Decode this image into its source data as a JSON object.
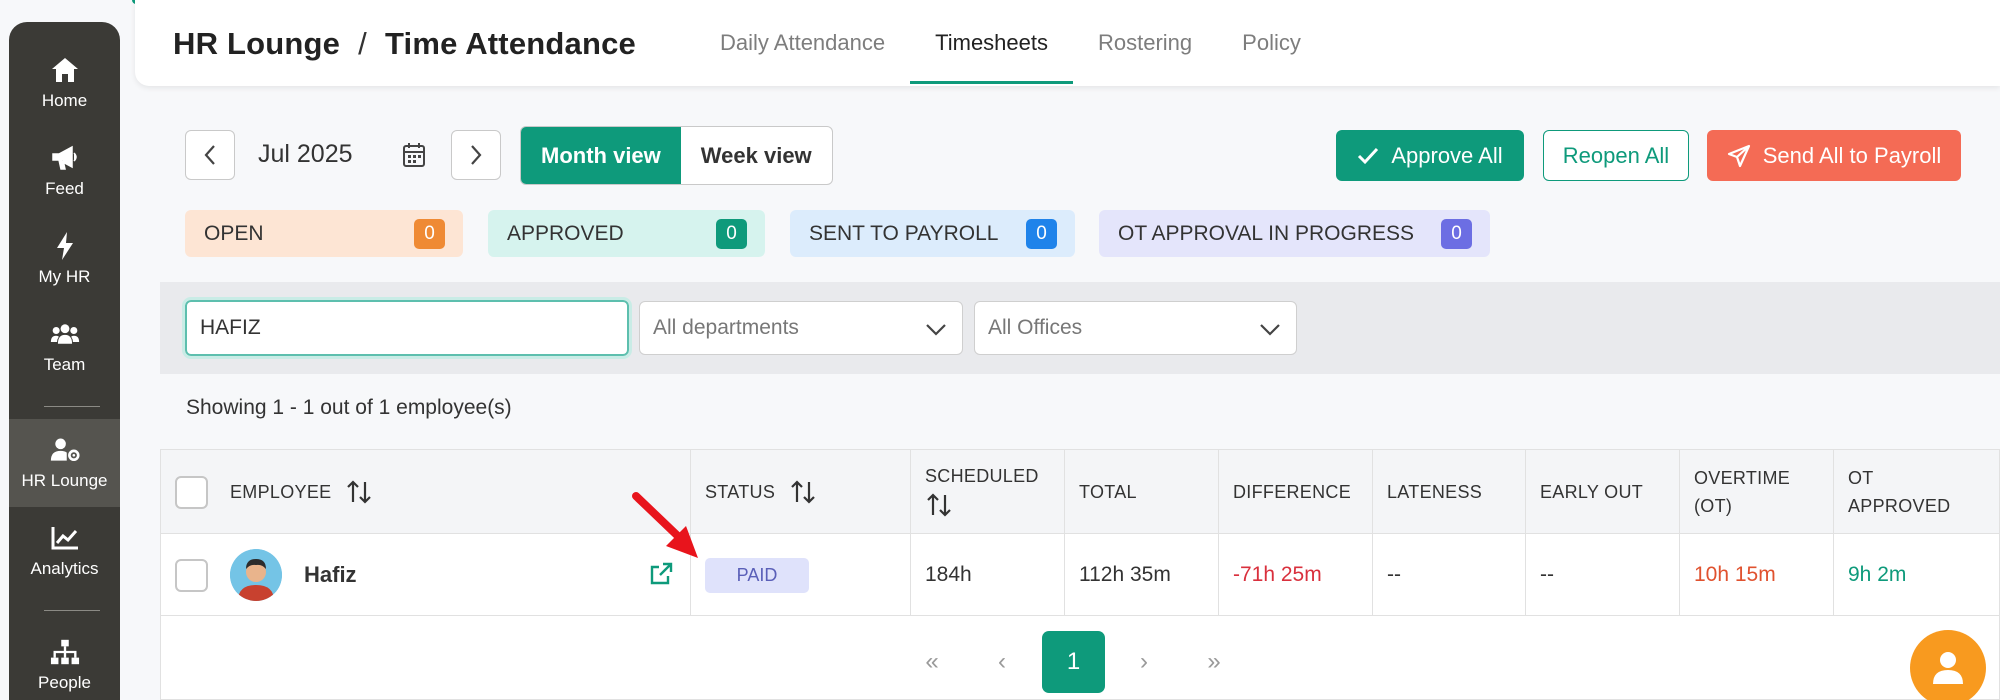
{
  "sidebar": {
    "items": [
      {
        "label": "Home",
        "icon": "home-icon"
      },
      {
        "label": "Feed",
        "icon": "megaphone-icon"
      },
      {
        "label": "My HR",
        "icon": "bolt-icon"
      },
      {
        "label": "Team",
        "icon": "team-icon"
      },
      {
        "label": "HR Lounge",
        "icon": "user-gear-icon"
      },
      {
        "label": "Analytics",
        "icon": "chart-icon"
      },
      {
        "label": "People",
        "icon": "org-chart-icon"
      }
    ]
  },
  "header": {
    "crumb_root": "HR Lounge",
    "crumb_sep": "/",
    "crumb_page": "Time Attendance",
    "tabs": [
      "Daily Attendance",
      "Timesheets",
      "Rostering",
      "Policy"
    ]
  },
  "toolbar": {
    "month": "Jul 2025",
    "month_view": "Month view",
    "week_view": "Week view",
    "approve_all": "Approve All",
    "reopen_all": "Reopen All",
    "send_all": "Send All to Payroll"
  },
  "status_chips": [
    {
      "label": "OPEN",
      "count": "0",
      "bg": "#fde5d4",
      "badge": "#ef8a34"
    },
    {
      "label": "APPROVED",
      "count": "0",
      "bg": "#d6f3ee",
      "badge": "#0e9a7b"
    },
    {
      "label": "SENT TO PAYROLL",
      "count": "0",
      "bg": "#dcecfc",
      "badge": "#1f83ea"
    },
    {
      "label": "OT APPROVAL IN PROGRESS",
      "count": "0",
      "bg": "#e4e5fb",
      "badge": "#6c6ee3"
    }
  ],
  "filters": {
    "search_value": "HAFIZ",
    "department": "All departments",
    "office": "All Offices"
  },
  "showing": "Showing 1 - 1 out of 1 employee(s)",
  "table": {
    "columns": {
      "employee": "EMPLOYEE",
      "status": "STATUS",
      "scheduled": "SCHEDULED",
      "total": "TOTAL",
      "difference": "DIFFERENCE",
      "lateness": "LATENESS",
      "early_out": "EARLY OUT",
      "overtime_1": "OVERTIME",
      "overtime_2": "(OT)",
      "ot_approved_1": "OT",
      "ot_approved_2": "APPROVED"
    },
    "rows": [
      {
        "name": "Hafiz",
        "status": "PAID",
        "scheduled": "184h",
        "total": "112h 35m",
        "difference": "-71h 25m",
        "lateness": "--",
        "early_out": "--",
        "overtime": "10h 15m",
        "ot_approved": "9h 2m"
      }
    ]
  },
  "pagination": {
    "first": "«",
    "prev": "‹",
    "current": "1",
    "next": "›",
    "last": "»"
  },
  "colors": {
    "accent": "#0e9a7b",
    "danger": "#f46b55"
  }
}
